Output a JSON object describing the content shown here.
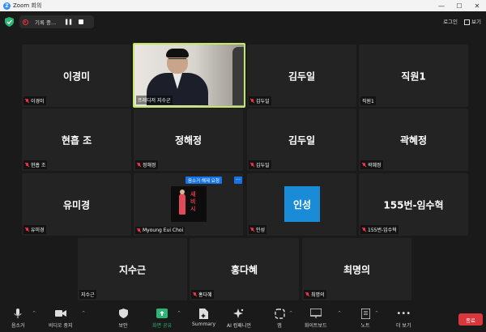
{
  "window": {
    "title": "Zoom 회의",
    "logo_letter": "Z",
    "minimize": "—",
    "maximize": "☐",
    "close": "✕"
  },
  "topbar": {
    "recording_label": "기록 중...",
    "pause_glyph": "❚❚",
    "right": {
      "origin_label": "로그인",
      "view_label": "보기"
    }
  },
  "tiles": [
    {
      "id": "t1",
      "display": "이경미",
      "label": "이경미",
      "muted": true
    },
    {
      "id": "t2",
      "display": "",
      "label": "프레디저 지수군",
      "muted": false,
      "active_speaker": true
    },
    {
      "id": "t3",
      "display": "김두일",
      "label": "김두일",
      "muted": true
    },
    {
      "id": "t4",
      "display": "직원1",
      "label": "직원1",
      "muted": false
    },
    {
      "id": "t5",
      "display": "현흡 조",
      "label": "현흡 조",
      "muted": true
    },
    {
      "id": "t6",
      "display": "정해정",
      "label": "정해정",
      "muted": true
    },
    {
      "id": "t7",
      "display": "김두일",
      "label": "김두일",
      "muted": true
    },
    {
      "id": "t8",
      "display": "곽혜정",
      "label": "곽혜정",
      "muted": true
    },
    {
      "id": "t9",
      "display": "유미경",
      "label": "유미경",
      "muted": true
    },
    {
      "id": "t10",
      "display": "",
      "label": "Myoung Eui Choi",
      "muted": true
    },
    {
      "id": "t11",
      "display": "",
      "label": "인성",
      "muted": true,
      "badge_text": "인성",
      "badge_color": "#1a8bd6"
    },
    {
      "id": "t12",
      "display": "155번-임수혁",
      "label": "155번-임수혁",
      "muted": true
    },
    {
      "id": "t13",
      "display": "지수근",
      "label": "지수근",
      "muted": false
    },
    {
      "id": "t14",
      "display": "홍다혜",
      "label": "홍다혜",
      "muted": true
    },
    {
      "id": "t15",
      "display": "최명의",
      "label": "최명의",
      "muted": true
    }
  ],
  "poster_text": [
    "새",
    "비",
    "시"
  ],
  "overlay": {
    "unmute_request": "음소거 해제 요청",
    "more": "···"
  },
  "toolbar": {
    "mute": "음소거",
    "video": "비디오 중지",
    "security": "보안",
    "share": "화면 공유",
    "summary": "Summary",
    "ai": "AI 컴패니언",
    "apps": "앱",
    "whiteboard": "화이트보드",
    "notes": "노트",
    "more": "더 보기",
    "end": "종료"
  },
  "colors": {
    "active_speaker_border": "#c6e665",
    "share_green": "#2bb673",
    "end_red": "#d9373c",
    "accent_blue": "#1674e6"
  }
}
